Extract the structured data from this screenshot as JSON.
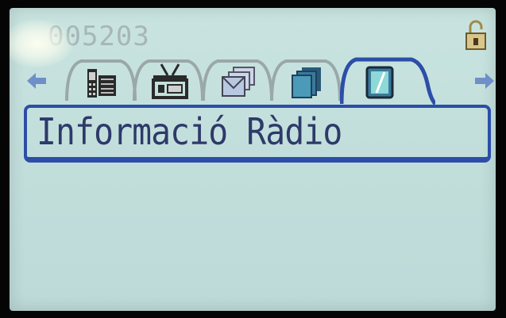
{
  "status_bar": {
    "radio_id": "005203",
    "lock_icon": "unlocked-padlock-icon"
  },
  "navigation": {
    "left_arrow_icon": "left-arrow-icon",
    "right_arrow_icon": "right-arrow-icon"
  },
  "tabs": [
    {
      "icon": "phone-contacts-icon",
      "selected": false
    },
    {
      "icon": "radio-tower-icon",
      "selected": false
    },
    {
      "icon": "messages-envelope-icon",
      "selected": false
    },
    {
      "icon": "stacked-pages-icon",
      "selected": false
    },
    {
      "icon": "radio-info-icon",
      "selected": true
    }
  ],
  "menu": {
    "selected_item": "Informació Ràdio"
  },
  "colors": {
    "screen_background": "#c3dfdc",
    "accent_blue": "#2c4ea8",
    "text_dark": "#2d3a6a",
    "inactive_gray": "#a7b6b6"
  }
}
